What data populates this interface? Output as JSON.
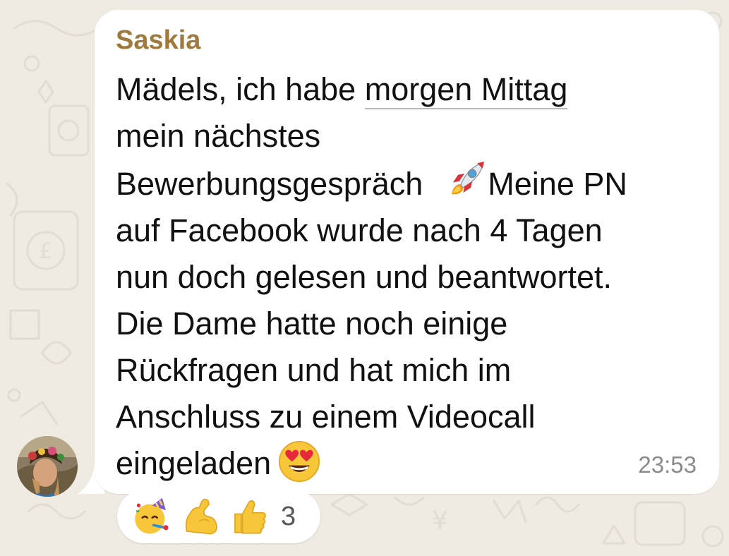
{
  "theme": {
    "wallpaper": "#efeae2",
    "bubble": "#ffffff",
    "sender_color": "#a07a3c",
    "meta_text": "#8a8a8a"
  },
  "message": {
    "sender": "Saskia",
    "line1_before": "Mädels, ich habe ",
    "line1_link": "morgen Mittag",
    "line2": "mein nächstes",
    "line3_before": "Bewerbungsgespräch",
    "line3_after": "Meine PN",
    "line4": "auf Facebook wurde nach 4 Tagen",
    "line5": "nun doch gelesen und beantwortet.",
    "line6": "Die Dame hatte noch einige",
    "line7": "Rückfragen und hat mich im",
    "line8": "Anschluss zu einem Videocall",
    "line9": "eingeladen",
    "time": "23:53",
    "emoji_icons": [
      "rocket-icon",
      "heart-eyes-icon"
    ]
  },
  "avatar": {
    "icon": "avatar-photo"
  },
  "reactions": {
    "items": [
      "partying-face-icon",
      "flexed-biceps-icon",
      "thumbs-up-icon"
    ],
    "count": "3"
  }
}
